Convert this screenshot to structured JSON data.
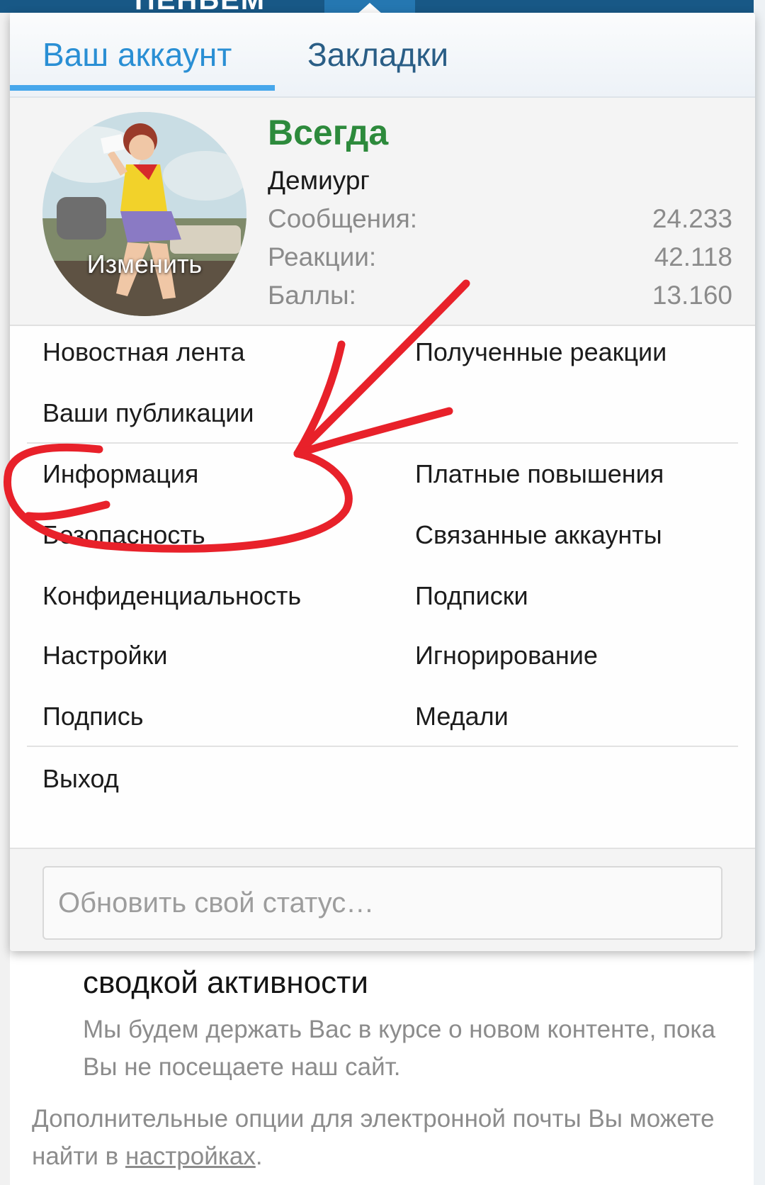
{
  "site": {
    "logo": "ПЕНЬЕМ"
  },
  "menu": {
    "tabs": [
      {
        "label": "Ваш аккаунт"
      },
      {
        "label": "Закладки"
      }
    ],
    "profile": {
      "avatar_action": "Изменить",
      "username": "Всегда",
      "user_title": "Демиург",
      "stats": [
        {
          "label": "Сообщения:",
          "value": "24.233"
        },
        {
          "label": "Реакции:",
          "value": "42.118"
        },
        {
          "label": "Баллы:",
          "value": "13.160"
        }
      ]
    },
    "links_left": [
      {
        "label": "Новостная лента"
      },
      {
        "label": "Ваши публикации"
      },
      {
        "label": "Информация"
      },
      {
        "label": "Безопасность"
      },
      {
        "label": "Конфиденциальность"
      },
      {
        "label": "Настройки"
      },
      {
        "label": "Подпись"
      },
      {
        "label": "Выход"
      }
    ],
    "links_right": [
      {
        "label": "Полученные реакции"
      },
      {
        "label": "Платные повышения"
      },
      {
        "label": "Связанные аккаунты"
      },
      {
        "label": "Подписки"
      },
      {
        "label": "Игнорирование"
      },
      {
        "label": "Медали"
      }
    ],
    "status_placeholder": "Обновить свой статус…"
  },
  "background": {
    "heading": "сводкой активности",
    "subtext": "Мы будем держать Вас в курсе о новом контенте, пока Вы не посещаете наш сайт.",
    "note_text": "Дополнительные опции для электронной почты Вы можете найти в",
    "note_link": "настройках",
    "note_end": "."
  },
  "colors": {
    "accent": "#2577b1",
    "tab_active": "#2a8fd4",
    "username": "#2d8a3c",
    "annotation": "#e8212a"
  }
}
